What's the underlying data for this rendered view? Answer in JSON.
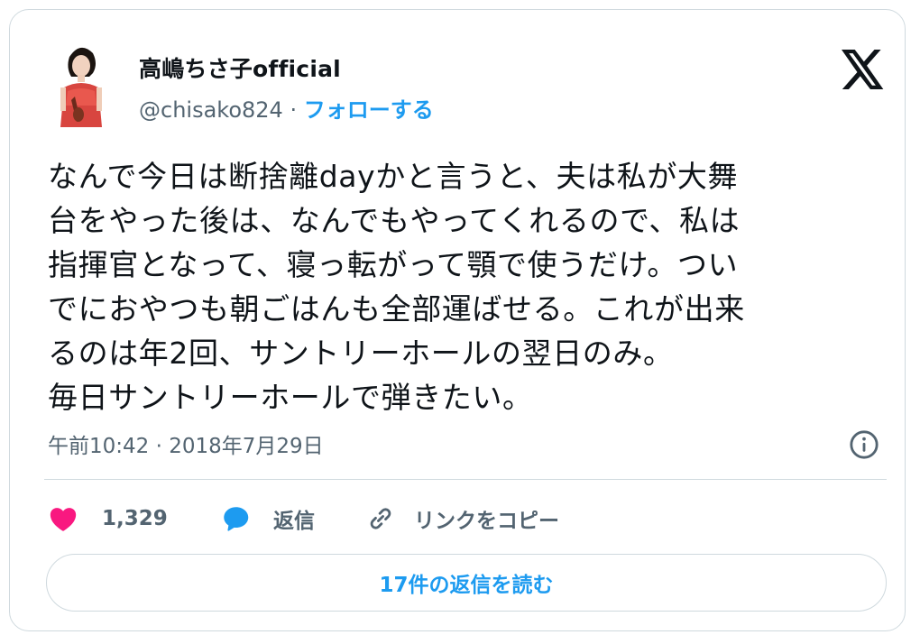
{
  "author": {
    "display_name": "高嶋ちさ子official",
    "handle": "@chisako824",
    "separator": "·",
    "follow_label": "フォローする"
  },
  "tweet": {
    "lines": [
      "なんで今日は断捨離dayかと言うと、夫は私が大舞",
      "台をやった後は、なんでもやってくれるので、私は",
      "指揮官となって、寝っ転がって顎で使うだけ。つい",
      "でにおやつも朝ごはんも全部運ばせる。これが出来",
      "るのは年2回、サントリーホールの翌日のみ。",
      "毎日サントリーホールで弾きたい。"
    ],
    "timestamp": "午前10:42 · 2018年7月29日"
  },
  "actions": {
    "like_count": "1,329",
    "reply_label": "返信",
    "copy_link_label": "リンクをコピー"
  },
  "read_replies_label": "17件の返信を読む",
  "colors": {
    "accent": "#1d9bf0",
    "like": "#f91880",
    "text": "#0f1419",
    "muted": "#536471",
    "border": "#cfd9de"
  },
  "icons": [
    "avatar",
    "x-logo-icon",
    "info-icon",
    "heart-icon",
    "reply-bubble-icon",
    "link-icon"
  ]
}
